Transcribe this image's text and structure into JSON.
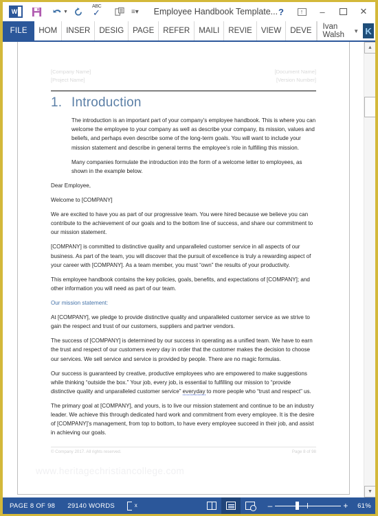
{
  "window": {
    "title": "Employee Handbook Template...",
    "quick_access": [
      {
        "name": "word-logo",
        "label": "W"
      },
      {
        "name": "save-icon",
        "label": "save"
      },
      {
        "name": "undo-icon",
        "label": "undo"
      },
      {
        "name": "redo-icon",
        "label": "redo"
      },
      {
        "name": "spelling-check-icon",
        "label": "ABC"
      },
      {
        "name": "print-preview-icon",
        "label": "print preview"
      },
      {
        "name": "customize-qat-icon",
        "label": "more"
      }
    ],
    "controls": {
      "help": "?",
      "ribbon_display_options": "ribbon-options",
      "minimize": "–",
      "maximize": "maximize",
      "close": "✕"
    }
  },
  "ribbon": {
    "file_tab": "FILE",
    "tabs": [
      "HOM",
      "INSER",
      "DESIG",
      "PAGE",
      "REFER",
      "MAILI",
      "REVIE",
      "VIEW",
      "DEVE"
    ],
    "account": {
      "name": "Ivan Walsh",
      "avatar_initial": "K"
    }
  },
  "document": {
    "header": {
      "left_line1": "[Company Name]",
      "left_line2": "[Project Name]",
      "right_line1": "[Document Name]",
      "right_line2": "[Version Number]"
    },
    "heading": {
      "number": "1.",
      "text": "Introduction"
    },
    "paragraphs": [
      {
        "style": "indent",
        "text": "The introduction is an important part of your company’s employee handbook. This is where you can welcome the employee to your company as well as describe your company, its mission, values and beliefs, and perhaps even describe some of the long-term goals. You will want to include your mission statement and describe in general terms the employee’s role in fulfilling this mission."
      },
      {
        "style": "indent",
        "text": "Many companies formulate the introduction into the form of a welcome letter to employees, as shown in the example below."
      },
      {
        "style": "normal",
        "text": "Dear Employee,"
      },
      {
        "style": "normal",
        "text": "Welcome to [COMPANY]"
      },
      {
        "style": "normal",
        "text": "We are excited to have you as part of our progressive team. You were hired because we believe you can contribute to the achievement of our goals and to the bottom line of success, and share our commitment to our mission statement."
      },
      {
        "style": "normal",
        "text": "[COMPANY] is committed to distinctive quality and unparalleled customer service in all aspects of our business. As part of the team, you will discover that the pursuit of excellence is truly a rewarding aspect of your career with [COMPANY]. As a team member, you must “own” the results of your productivity."
      },
      {
        "style": "normal",
        "text": "This employee handbook contains the key policies, goals, benefits, and expectations of [COMPANY]; and other information you will need as part of our team."
      },
      {
        "style": "mission",
        "text": "Our mission statement:"
      },
      {
        "style": "normal",
        "text": "At [COMPANY], we pledge to provide distinctive quality and unparalleled customer service as we strive to gain the respect and trust of our customers, suppliers and partner vendors."
      },
      {
        "style": "normal",
        "text": "The success of [COMPANY] is determined by our success in operating as a unified team. We have to earn the trust and respect of our customers every day in order that the customer makes the decision to choose our services. We sell service and service is provided by people. There are no magic formulas."
      },
      {
        "style": "squiggle",
        "text_before": "Our success is guaranteed by creative, productive employees who are empowered to make suggestions while thinking “outside the box.” Your job, every job, is essential to fulfilling our mission to “provide distinctive quality and unparalleled customer service” ",
        "squiggle_word": "everyday",
        "text_after": " to more people who “trust and respect” us."
      },
      {
        "style": "normal",
        "text": "The primary goal at [COMPANY], and yours, is to live our mission statement and continue to be an industry leader. We achieve this through dedicated hard work and commitment from every employee. It is the desire of [COMPANY]’s management, from top to bottom, to have every employee succeed in their job, and assist in achieving our goals."
      }
    ],
    "footer": {
      "left": "© Company 2017. All rights reserved.",
      "right": "Page 8 of 98"
    },
    "watermark": "www.heritagechristiancollege.com"
  },
  "status_bar": {
    "page_indicator": "PAGE 8 OF 98",
    "word_count": "29140 WORDS",
    "proofing_icon": "proofing-errors-icon",
    "views": [
      {
        "name": "read-mode-view-button",
        "label": "Read Mode",
        "active": false
      },
      {
        "name": "print-layout-view-button",
        "label": "Print Layout",
        "active": true
      },
      {
        "name": "web-layout-view-button",
        "label": "Web Layout",
        "active": false
      }
    ],
    "zoom_level": "61%",
    "zoom_minus": "–",
    "zoom_plus": "+"
  },
  "colors": {
    "window_border": "#d3b83a",
    "word_blue": "#2b579a",
    "heading_blue": "#5b7fa6",
    "mission_blue": "#4472a8"
  }
}
